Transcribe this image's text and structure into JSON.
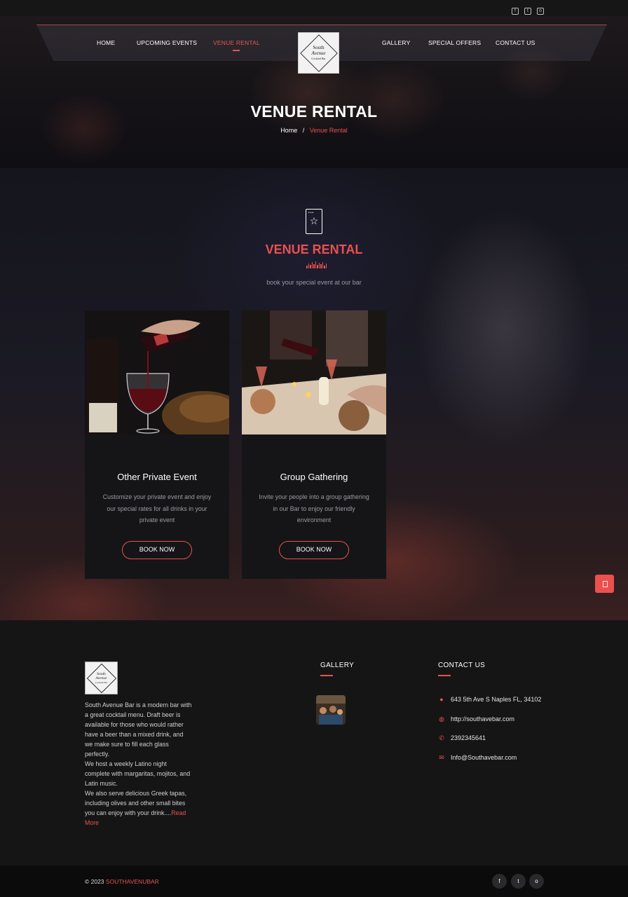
{
  "topbar": {
    "icons": [
      "facebook-icon",
      "twitter-icon",
      "instagram-icon"
    ]
  },
  "nav": {
    "left": [
      "HOME",
      "UPCOMING EVENTS",
      "VENUE RENTAL"
    ],
    "right": [
      "GALLERY",
      "SPECIAL OFFERS",
      "CONTACT US"
    ],
    "active": "VENUE RENTAL"
  },
  "logo": {
    "line1": "South",
    "line2": "Avenue",
    "line3": "Cocktail Bar"
  },
  "hero": {
    "title": "VENUE RENTAL",
    "breadcrumb_home": "Home",
    "breadcrumb_sep": "/",
    "breadcrumb_current": "Venue Rental"
  },
  "section": {
    "icon": "event-ticket-star-icon",
    "title": "VENUE RENTAL",
    "subtitle": "book your special event at our bar"
  },
  "cards": [
    {
      "title": "Other Private Event",
      "text": "Customize your private event and enjoy our special rates for all drinks in your private event",
      "button": "BOOK NOW"
    },
    {
      "title": "Group Gathering",
      "text": "Invite your people into a group gathering in our Bar to enjoy our friendly environment",
      "button": "BOOK NOW"
    }
  ],
  "footer": {
    "about": [
      "South Avenue Bar is a modern bar with a great cocktail menu. Draft beer is available for those who would rather have a beer than a mixed drink, and we make sure to fill each glass perfectly.",
      "We host a weekly Latino night complete with margaritas, mojitos, and Latin music.",
      "We also serve delicious Greek tapas, including olives and other small bites you can enjoy with your drink...."
    ],
    "read_more": "Read More",
    "gallery_title": "GALLERY",
    "contact_title": "CONTACT US",
    "contact": {
      "address": "643 5th Ave S Naples FL, 34102",
      "website": "http://southavebar.com",
      "phone": "2392345641",
      "email": "Info@Southavebar.com"
    }
  },
  "bottom": {
    "copyright": "© 2023",
    "brand": "SOUTHAVENUBAR",
    "social_icons": [
      "facebook-icon",
      "twitter-icon",
      "instagram-icon"
    ]
  },
  "colors": {
    "accent": "#e9514f",
    "background": "#151516"
  }
}
